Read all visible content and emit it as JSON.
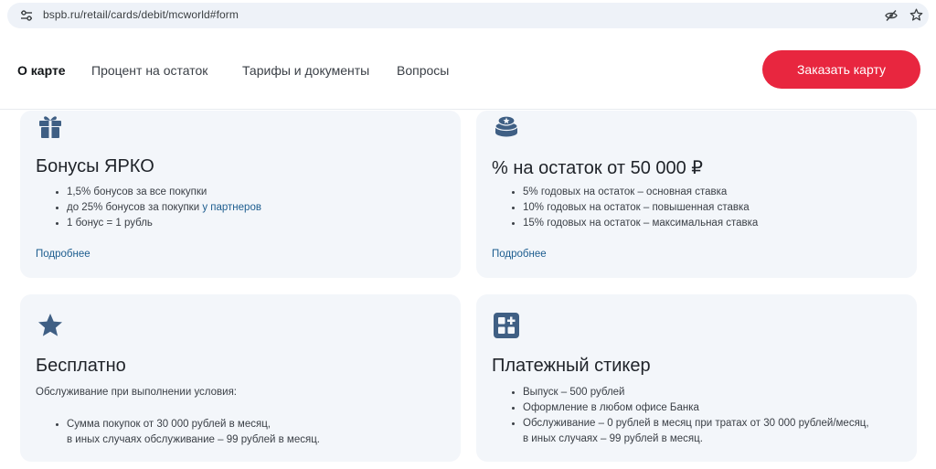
{
  "browser": {
    "url": "bspb.ru/retail/cards/debit/mcworld#form",
    "icons": [
      "site-settings-icon",
      "eye-off-icon",
      "bookmark-star-icon"
    ]
  },
  "header": {
    "nav": [
      {
        "label": "О карте",
        "active": true
      },
      {
        "label": "Процент на остаток",
        "active": false
      },
      {
        "label": "Тарифы и документы",
        "active": false
      },
      {
        "label": "Вопросы",
        "active": false
      }
    ],
    "cta_label": "Заказать карту"
  },
  "cards": {
    "bonuses": {
      "icon": "gift-icon",
      "title": "Бонусы ЯРКО",
      "items": [
        "1,5% бонусов за все покупки",
        "до 25% бонусов за покупки ",
        "1 бонус = 1 рубль"
      ],
      "item2_link": "у партнеров",
      "link": "Подробнее"
    },
    "interest": {
      "icon": "coins-icon",
      "title": "% на остаток от 50 000 ₽",
      "items": [
        "5% годовых на остаток – основная ставка",
        "10% годовых на остаток – повышенная ставка",
        "15% годовых на остаток – максимальная ставка"
      ],
      "link": "Подробнее"
    },
    "free": {
      "icon": "star-icon",
      "title": "Бесплатно",
      "note": "Обслуживание при выполнении условия:",
      "items": [
        {
          "line1": "Сумма покупок от 30 000 рублей в месяц,",
          "line2": "в иных случаях обслуживание  – 99 рублей в месяц."
        }
      ]
    },
    "sticker": {
      "icon": "apps-grid-icon",
      "title": "Платежный стикер",
      "items": [
        {
          "line1": "Выпуск – 500 рублей",
          "line2": ""
        },
        {
          "line1": "Оформление в любом офисе Банка",
          "line2": ""
        },
        {
          "line1": "Обслуживание  – 0 рублей в месяц при тратах от 30 000 рублей/месяц,",
          "line2": "в иных случаях  – 99 рублей в месяц."
        }
      ]
    }
  },
  "colors": {
    "accent": "#e8263f",
    "link": "#1d5d8f",
    "icon": "#3f5f84",
    "card_bg": "#f3f6fa"
  }
}
